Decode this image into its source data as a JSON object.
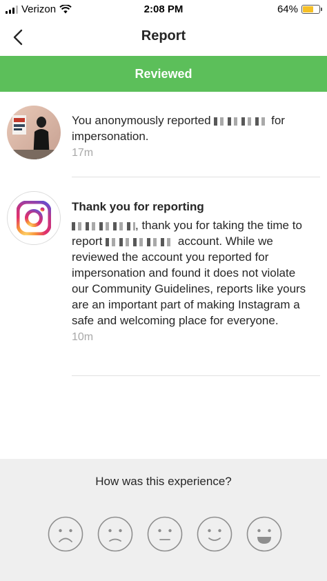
{
  "status_bar": {
    "carrier": "Verizon",
    "time": "2:08 PM",
    "battery": "64%",
    "battery_level": 0.64
  },
  "nav": {
    "title": "Report",
    "back_icon": "chevron-left-icon"
  },
  "banner": {
    "text": "Reviewed",
    "color": "#5cbf5a"
  },
  "report": {
    "line_prefix": "You anonymously reported",
    "line_suffix": "for",
    "line_second": "impersonation.",
    "time": "17m"
  },
  "response": {
    "heading": "Thank you for reporting",
    "line1_suffix": ", thank you for taking the time to",
    "line2_prefix": "report",
    "line2_suffix": "account. While we",
    "body": "reviewed the account you reported for impersonation and found it does not violate our Community Guidelines, reports like yours are an important part of making Instagram a safe and welcoming place for everyone.",
    "time": "10m",
    "icon": "instagram-logo-icon"
  },
  "feedback": {
    "question": "How was this experience?",
    "options": [
      "very-sad-face-icon",
      "sad-face-icon",
      "neutral-face-icon",
      "happy-face-icon",
      "very-happy-face-icon"
    ]
  }
}
